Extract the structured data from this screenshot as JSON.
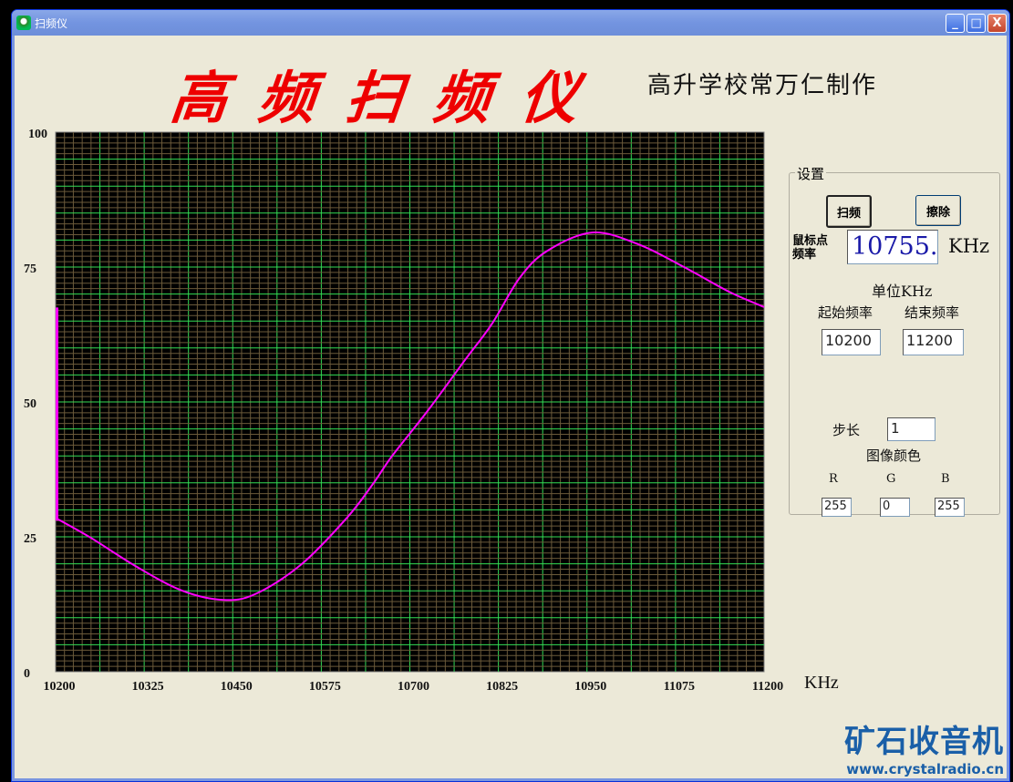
{
  "window": {
    "title": "扫频仪"
  },
  "header": {
    "title": "高频扫频仪",
    "author": "高升学校常万仁制作"
  },
  "settings": {
    "group_label": "设置",
    "sweep_button": "扫频",
    "erase_button": "擦除",
    "cursor_freq_label_1": "鼠标点",
    "cursor_freq_label_2": "频率",
    "cursor_freq_value": "10755.",
    "cursor_freq_unit": "KHz",
    "unit_label": "单位KHz",
    "start_freq_label": "起始频率",
    "end_freq_label": "结束频率",
    "start_freq_value": "10200",
    "end_freq_value": "11200",
    "step_label": "步长",
    "step_value": "1",
    "color_label": "图像颜色",
    "r_label": "R",
    "g_label": "G",
    "b_label": "B",
    "r_value": "255",
    "g_value": "0",
    "b_value": "255"
  },
  "watermark": {
    "line1": "矿石收音机",
    "line2": "www.crystalradio.cn"
  },
  "chart_data": {
    "type": "line",
    "xlabel": "KHz",
    "xlim": [
      10200,
      11200
    ],
    "ylim": [
      0,
      100
    ],
    "x_ticks": [
      "10200",
      "10325",
      "10450",
      "10575",
      "10700",
      "10825",
      "10950",
      "11075",
      "11200"
    ],
    "y_ticks": [
      "0",
      "25",
      "50",
      "75",
      "100"
    ],
    "grid": true,
    "background": "#000000",
    "grid_major_color": "#33dd55",
    "grid_minor_color": "#6b5a3a",
    "line_color": "#ff00ff",
    "initial_spike": {
      "x": 10200,
      "y_from": 28,
      "y_to": 67.5
    },
    "x": [
      10200,
      10250,
      10315,
      10379,
      10437,
      10482,
      10546,
      10611,
      10649,
      10675,
      10726,
      10778,
      10816,
      10855,
      10894,
      10958,
      11023,
      11087,
      11151,
      11200
    ],
    "y": [
      28.5,
      24.8,
      19.4,
      15.0,
      13.3,
      14.4,
      19.8,
      28.5,
      35.0,
      40.0,
      48.5,
      57.8,
      64.5,
      73.0,
      78.0,
      81.4,
      79.2,
      75.0,
      70.4,
      67.6
    ]
  }
}
